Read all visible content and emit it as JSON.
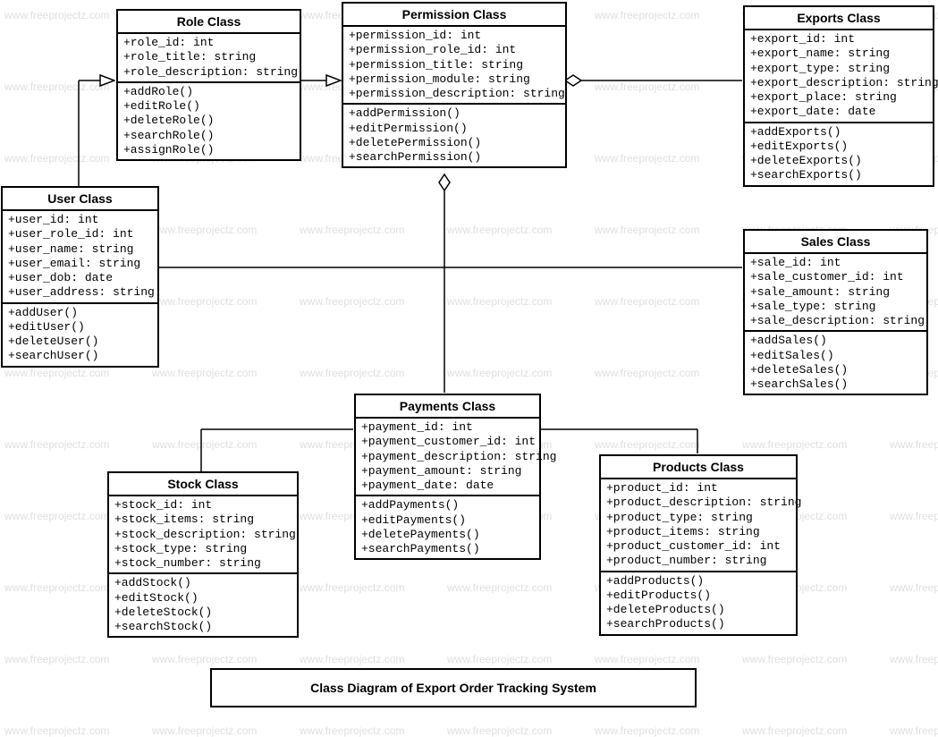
{
  "watermark_text": "www.freeprojectz.com",
  "diagram_title": "Class Diagram of Export Order Tracking System",
  "classes": {
    "role": {
      "title": "Role Class",
      "attrs": [
        "+role_id: int",
        "+role_title: string",
        "+role_description: string"
      ],
      "ops": [
        "+addRole()",
        "+editRole()",
        "+deleteRole()",
        "+searchRole()",
        "+assignRole()"
      ]
    },
    "permission": {
      "title": "Permission Class",
      "attrs": [
        "+permission_id: int",
        "+permission_role_id: int",
        "+permission_title: string",
        "+permission_module: string",
        "+permission_description: string"
      ],
      "ops": [
        "+addPermission()",
        "+editPermission()",
        "+deletePermission()",
        "+searchPermission()"
      ]
    },
    "exports": {
      "title": "Exports Class",
      "attrs": [
        "+export_id: int",
        "+export_name: string",
        "+export_type: string",
        "+export_description: string",
        "+export_place: string",
        "+export_date: date"
      ],
      "ops": [
        "+addExports()",
        "+editExports()",
        "+deleteExports()",
        "+searchExports()"
      ]
    },
    "user": {
      "title": "User Class",
      "attrs": [
        "+user_id: int",
        "+user_role_id: int",
        "+user_name: string",
        "+user_email: string",
        "+user_dob: date",
        "+user_address: string"
      ],
      "ops": [
        "+addUser()",
        "+editUser()",
        "+deleteUser()",
        "+searchUser()"
      ]
    },
    "sales": {
      "title": "Sales Class",
      "attrs": [
        "+sale_id: int",
        "+sale_customer_id: int",
        "+sale_amount: string",
        "+sale_type: string",
        "+sale_description: string"
      ],
      "ops": [
        "+addSales()",
        "+editSales()",
        "+deleteSales()",
        "+searchSales()"
      ]
    },
    "payments": {
      "title": "Payments Class",
      "attrs": [
        "+payment_id: int",
        "+payment_customer_id: int",
        "+payment_description: string",
        "+payment_amount: string",
        "+payment_date: date"
      ],
      "ops": [
        "+addPayments()",
        "+editPayments()",
        "+deletePayments()",
        "+searchPayments()"
      ]
    },
    "stock": {
      "title": "Stock Class",
      "attrs": [
        "+stock_id: int",
        "+stock_items: string",
        "+stock_description: string",
        "+stock_type: string",
        "+stock_number: string"
      ],
      "ops": [
        "+addStock()",
        "+editStock()",
        "+deleteStock()",
        "+searchStock()"
      ]
    },
    "products": {
      "title": "Products Class",
      "attrs": [
        "+product_id: int",
        "+product_description: string",
        "+product_type: string",
        "+product_items: string",
        "+product_customer_id: int",
        "+product_number: string"
      ],
      "ops": [
        "+addProducts()",
        "+editProducts()",
        "+deleteProducts()",
        "+searchProducts()"
      ]
    }
  }
}
